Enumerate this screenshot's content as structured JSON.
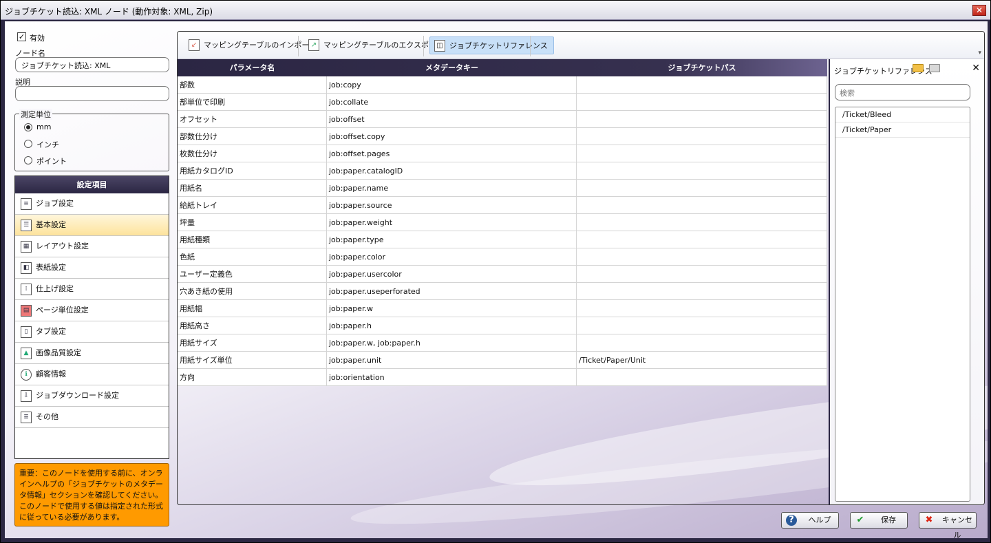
{
  "window": {
    "title": "ジョブチケット読込: XML ノード (動作対象: XML, Zip)"
  },
  "left": {
    "enabled_label": "有効",
    "node_name_label": "ノード名",
    "node_name_value": "ジョブチケット読込: XML",
    "description_label": "説明",
    "description_value": "",
    "units": {
      "label": "測定単位",
      "options": [
        "mm",
        "インチ",
        "ポイント"
      ],
      "selected": "mm"
    },
    "settings": {
      "header": "設定項目",
      "items": [
        {
          "label": "ジョブ設定",
          "icon": "document-icon"
        },
        {
          "label": "基本設定",
          "icon": "list-icon"
        },
        {
          "label": "レイアウト設定",
          "icon": "layout-icon"
        },
        {
          "label": "表紙設定",
          "icon": "cover-icon"
        },
        {
          "label": "仕上げ設定",
          "icon": "finishing-icon"
        },
        {
          "label": "ページ単位設定",
          "icon": "pages-icon"
        },
        {
          "label": "タブ設定",
          "icon": "tab-icon"
        },
        {
          "label": "画像品質設定",
          "icon": "image-icon"
        },
        {
          "label": "顧客情報",
          "icon": "customer-icon"
        },
        {
          "label": "ジョブダウンロード設定",
          "icon": "download-icon"
        },
        {
          "label": "その他",
          "icon": "other-icon"
        }
      ],
      "selected_index": 1
    },
    "warning": "重要：このノードを使用する前に、オンラインヘルプの「ジョブチケットのメタデータ情報」セクションを確認してください。このノードで使用する値は指定された形式に従っている必要があります。"
  },
  "toolbar": {
    "import_label": "マッピングテーブルのインポート",
    "export_label": "マッピングテーブルのエクスポート",
    "reference_label": "ジョブチケットリファレンス"
  },
  "grid": {
    "columns": [
      "パラメータ名",
      "メタデータキー",
      "ジョブチケットパス"
    ],
    "rows": [
      [
        "部数",
        "job:copy",
        ""
      ],
      [
        "部単位で印刷",
        "job:collate",
        ""
      ],
      [
        "オフセット",
        "job:offset",
        ""
      ],
      [
        "部数仕分け",
        "job:offset.copy",
        ""
      ],
      [
        "枚数仕分け",
        "job:offset.pages",
        ""
      ],
      [
        "用紙カタログID",
        "job:paper.catalogID",
        ""
      ],
      [
        "用紙名",
        "job:paper.name",
        ""
      ],
      [
        "給紙トレイ",
        "job:paper.source",
        ""
      ],
      [
        "坪量",
        "job:paper.weight",
        ""
      ],
      [
        "用紙種類",
        "job:paper.type",
        ""
      ],
      [
        "色紙",
        "job:paper.color",
        ""
      ],
      [
        "ユーザー定義色",
        "job:paper.usercolor",
        ""
      ],
      [
        "穴あき紙の使用",
        "job:paper.useperforated",
        ""
      ],
      [
        "用紙幅",
        "job:paper.w",
        ""
      ],
      [
        "用紙高さ",
        "job:paper.h",
        ""
      ],
      [
        "用紙サイズ",
        "job:paper.w, job:paper.h",
        ""
      ],
      [
        "用紙サイズ単位",
        "job:paper.unit",
        "/Ticket/Paper/Unit"
      ],
      [
        "方向",
        "job:orientation",
        ""
      ]
    ]
  },
  "reference": {
    "title": "ジョブチケットリファレンス",
    "search_placeholder": "検索",
    "items": [
      "/Ticket/Bleed",
      "/Ticket/Paper"
    ]
  },
  "buttons": {
    "help": "ヘルプ",
    "save": "保存",
    "cancel": "キャンセル"
  }
}
